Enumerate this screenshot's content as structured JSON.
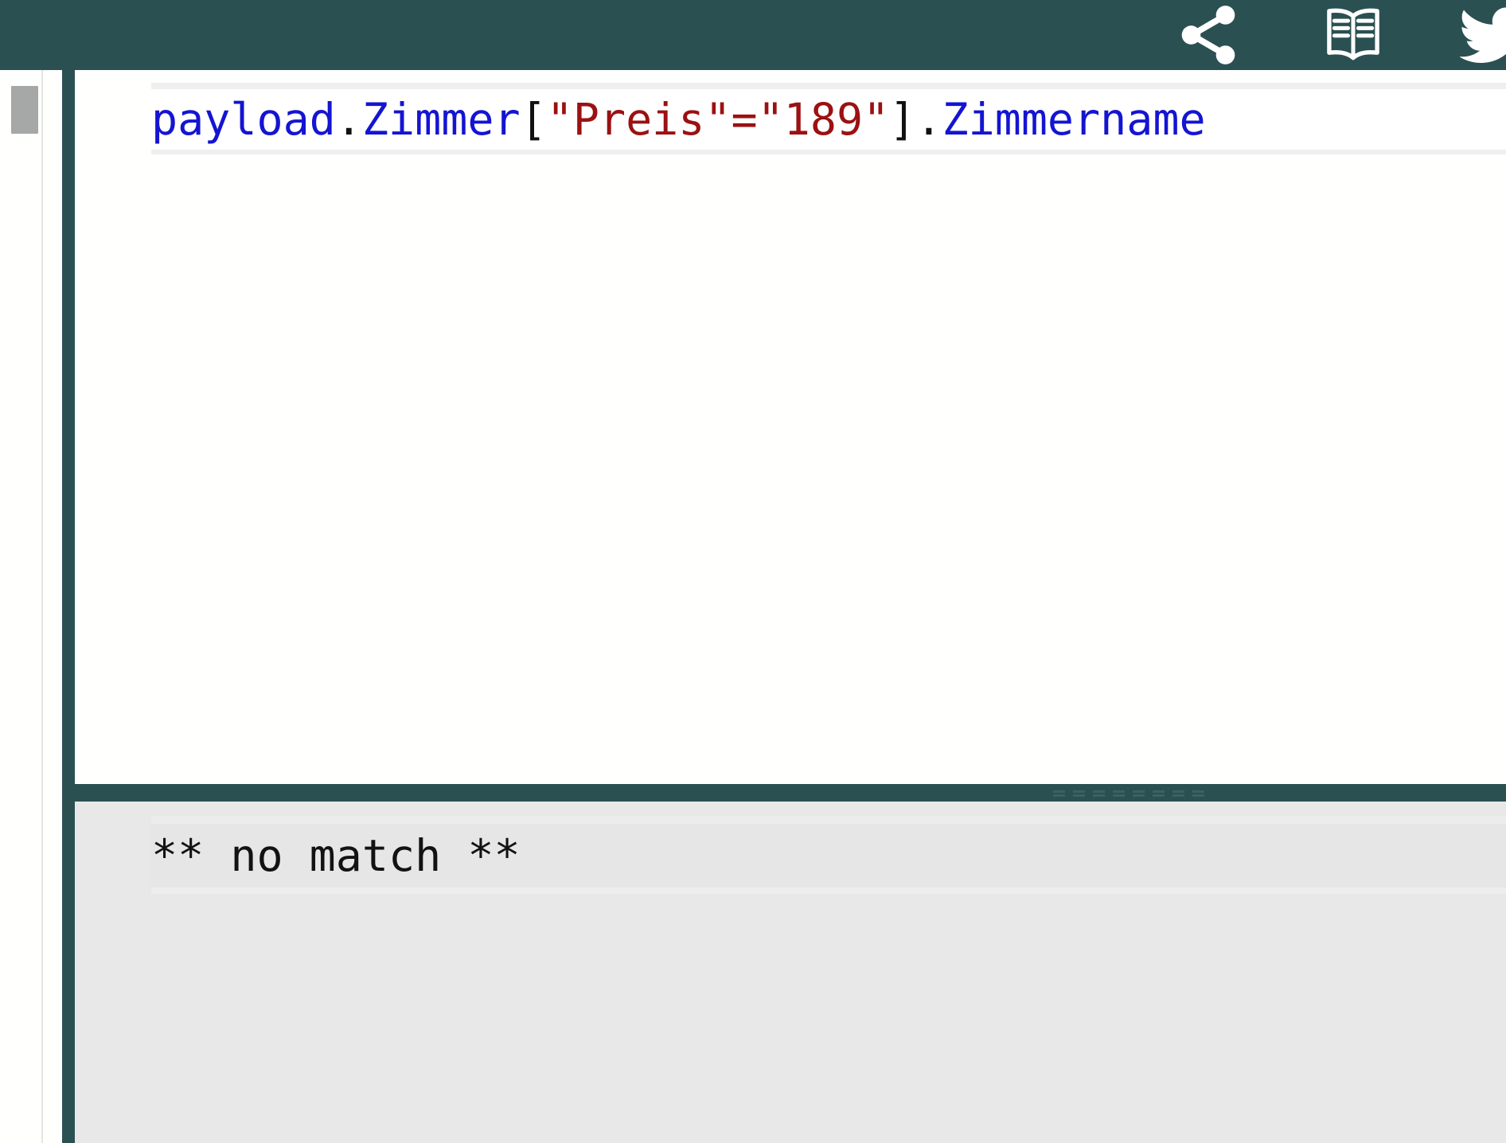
{
  "appbar": {
    "background": "#2A5052",
    "actions": [
      {
        "name": "share",
        "icon": "share-icon",
        "label": "Share"
      },
      {
        "name": "docs",
        "icon": "open-book-icon",
        "label": "Documentation"
      },
      {
        "name": "twitter",
        "icon": "bird-icon",
        "label": "Twitter"
      }
    ]
  },
  "editor": {
    "expression": "payload.Zimmer[\"Preis\"=\"189\"].Zimmername",
    "tokens": [
      {
        "text": "payload",
        "type": "identifier"
      },
      {
        "text": ".",
        "type": "punctuation"
      },
      {
        "text": "Zimmer",
        "type": "identifier"
      },
      {
        "text": "[",
        "type": "punctuation"
      },
      {
        "text": "\"Preis\"",
        "type": "string"
      },
      {
        "text": "=",
        "type": "string"
      },
      {
        "text": "\"189\"",
        "type": "string"
      },
      {
        "text": "]",
        "type": "punctuation"
      },
      {
        "text": ".",
        "type": "punctuation"
      },
      {
        "text": "Zimmername",
        "type": "identifier"
      }
    ],
    "colors": {
      "identifier": "#1414D2",
      "punctuation": "#111111",
      "string": "#9B1111",
      "background": "#FFFFFE"
    }
  },
  "results": {
    "output": "** no match **",
    "background": "#E8E8E8"
  },
  "scrollbar": {
    "thumb_color": "#A6A8A8"
  }
}
